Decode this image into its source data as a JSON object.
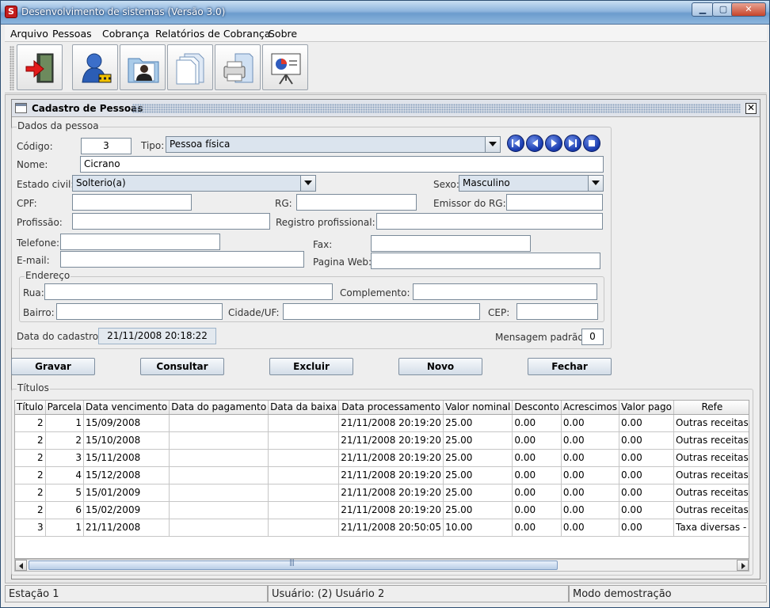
{
  "window": {
    "title": "Desenvolvimento de sistemas (Versão 3.0)",
    "app_icon": "S"
  },
  "menu": [
    {
      "label": "Arquivo"
    },
    {
      "label": "Pessoas"
    },
    {
      "label": "Cobrança"
    },
    {
      "label": "Relatórios de Cobrança"
    },
    {
      "label": "Sobre"
    }
  ],
  "toolbar_icons": [
    "exit-door-icon",
    "user-icon",
    "people-folder-icon",
    "documents-icon",
    "printer-icon",
    "presentation-chart-icon"
  ],
  "frame": {
    "title": "Cadastro de Pessoas",
    "close_glyph": "✕"
  },
  "person": {
    "group_label": "Dados da pessoa",
    "codigo_label": "Código:",
    "codigo": "3",
    "tipo_label": "Tipo:",
    "tipo": "Pessoa física",
    "nome_label": "Nome:",
    "nome": "Cicrano",
    "estado_civil_label": "Estado civil:",
    "estado_civil": "Solterio(a)",
    "sexo_label": "Sexo:",
    "sexo": "Masculino",
    "cpf_label": "CPF:",
    "cpf": "",
    "rg_label": "RG:",
    "rg": "",
    "emissor_label": "Emissor do RG:",
    "emissor": "",
    "profissao_label": "Profissão:",
    "profissao": "",
    "registro_label": "Registro profissional:",
    "registro": "",
    "telefone_label": "Telefone:",
    "telefone": "",
    "fax_label": "Fax:",
    "fax": "",
    "email_label": "E-mail:",
    "email": "",
    "web_label": "Pagina Web:",
    "web": "",
    "data_cadastro_label": "Data do cadastro:",
    "data_cadastro": "21/11/2008 20:18:22",
    "mensagem_label": "Mensagem padrão:",
    "mensagem": "0"
  },
  "address": {
    "group_label": "Endereço",
    "rua_label": "Rua:",
    "rua": "",
    "complemento_label": "Complemento:",
    "complemento": "",
    "bairro_label": "Bairro:",
    "bairro": "",
    "cidade_label": "Cidade/UF:",
    "cidade": "",
    "cep_label": "CEP:",
    "cep": ""
  },
  "nav_buttons": [
    "first-record-icon",
    "previous-record-icon",
    "next-record-icon",
    "last-record-icon",
    "stop-icon"
  ],
  "actions": {
    "gravar": "Gravar",
    "consultar": "Consultar",
    "excluir": "Excluir",
    "novo": "Novo",
    "fechar": "Fechar"
  },
  "titulos": {
    "group_label": "Títulos",
    "columns": [
      "Título",
      "Parcela",
      "Data vencimento",
      "Data do pagamento",
      "Data da baixa",
      "Data processamento",
      "Valor nominal",
      "Desconto",
      "Acrescimos",
      "Valor pago",
      "Refe"
    ],
    "rows": [
      [
        "2",
        "1",
        "15/09/2008",
        "",
        "",
        "21/11/2008 20:19:20",
        "25.00",
        "0.00",
        "0.00",
        "0.00",
        "Outras receitas"
      ],
      [
        "2",
        "2",
        "15/10/2008",
        "",
        "",
        "21/11/2008 20:19:20",
        "25.00",
        "0.00",
        "0.00",
        "0.00",
        "Outras receitas"
      ],
      [
        "2",
        "3",
        "15/11/2008",
        "",
        "",
        "21/11/2008 20:19:20",
        "25.00",
        "0.00",
        "0.00",
        "0.00",
        "Outras receitas"
      ],
      [
        "2",
        "4",
        "15/12/2008",
        "",
        "",
        "21/11/2008 20:19:20",
        "25.00",
        "0.00",
        "0.00",
        "0.00",
        "Outras receitas"
      ],
      [
        "2",
        "5",
        "15/01/2009",
        "",
        "",
        "21/11/2008 20:19:20",
        "25.00",
        "0.00",
        "0.00",
        "0.00",
        "Outras receitas"
      ],
      [
        "2",
        "6",
        "15/02/2009",
        "",
        "",
        "21/11/2008 20:19:20",
        "25.00",
        "0.00",
        "0.00",
        "0.00",
        "Outras receitas"
      ],
      [
        "3",
        "1",
        "21/11/2008",
        "",
        "",
        "21/11/2008 20:50:05",
        "10.00",
        "0.00",
        "0.00",
        "0.00",
        "Taxa diversas -"
      ]
    ]
  },
  "status": {
    "estacao": "Estação 1",
    "usuario": "Usuário: (2) Usuário 2",
    "modo": "Modo demostração"
  }
}
